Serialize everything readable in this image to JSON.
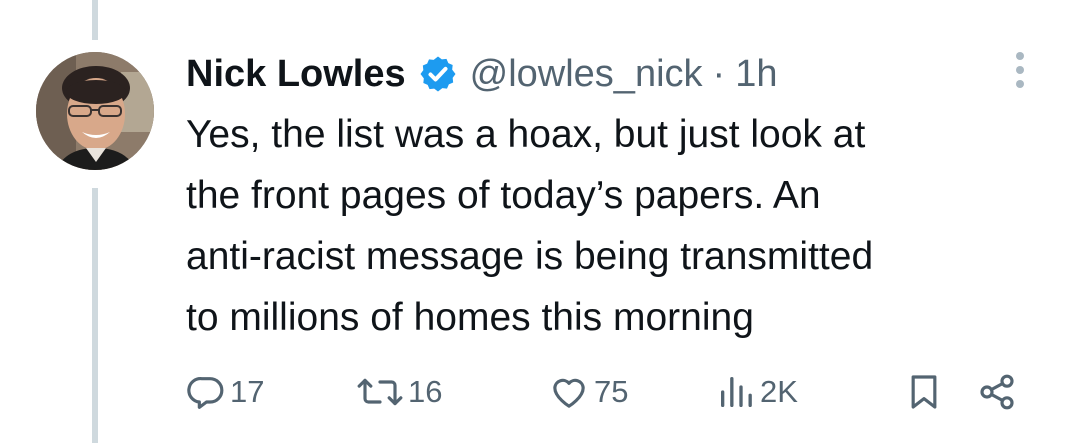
{
  "tweet": {
    "author_name": "Nick Lowles",
    "handle": "@lowles_nick",
    "separator": "·",
    "time": "1h",
    "text_lines": [
      "Yes, the list was a hoax, but just look at",
      "the front pages of today’s papers. An",
      "anti-racist message is being transmitted",
      "to millions of homes this morning"
    ]
  },
  "actions": {
    "replies": "17",
    "retweets": "16",
    "likes": "75",
    "views": "2K"
  },
  "colors": {
    "text": "#0f1419",
    "secondary": "#536471",
    "verified": "#1d9bf0",
    "thread_line": "#cfd9de"
  },
  "icons": {
    "verified": "verified-badge-icon",
    "more": "more-vertical-icon",
    "reply": "reply-icon",
    "retweet": "retweet-icon",
    "like": "heart-icon",
    "views": "views-chart-icon",
    "bookmark": "bookmark-icon",
    "share": "share-icon"
  }
}
